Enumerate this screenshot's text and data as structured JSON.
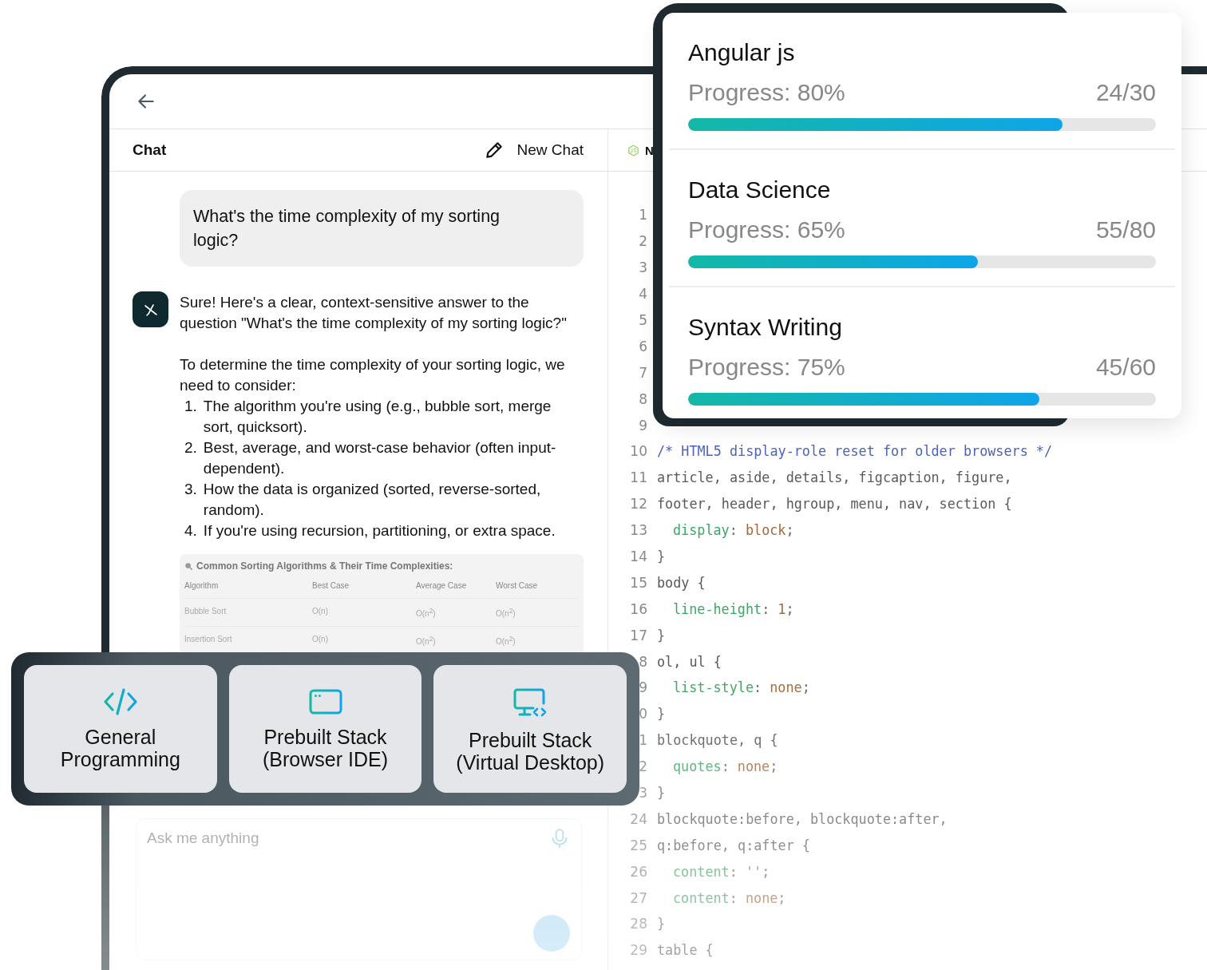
{
  "chat": {
    "title": "Chat",
    "new_chat": "New Chat",
    "messages": [
      {
        "kind": "question",
        "text": "What's the time complexity of my sorting logic?"
      },
      {
        "kind": "answer",
        "paragraphs": [
          "Sure! Here's a clear, context-sensitive answer to the question \"What's the time complexity of my sorting logic?\"",
          "To determine the time complexity of your sorting logic, we need to consider:"
        ],
        "list": [
          {
            "number": "1.",
            "text": "The algorithm you're using (e.g., bubble sort, merge sort, quicksort)."
          },
          {
            "number": "2.",
            "text": "Best, average, and worst-case behavior (often input-dependent)."
          },
          {
            "number": "3.",
            "text": "How the data is organized (sorted, reverse-sorted, random)."
          },
          {
            "number": "4.",
            "text": "If you're using recursion, partitioning, or extra space."
          }
        ],
        "table": {
          "title": "Common Sorting Algorithms & Their Time Complexities:",
          "columns": [
            "Algorithm",
            "Best Case",
            "Average Case",
            "Worst Case"
          ],
          "rows": [
            [
              "Bubble Sort",
              "O(n)",
              "O(n$^{2}$)",
              "O(n$^{2}$)"
            ],
            [
              "Insertion Sort",
              "O(n)",
              "O(n$^{2}$)",
              "O(n$^{2}$)"
            ]
          ]
        }
      }
    ],
    "input": {
      "placeholder": "Ask me anything"
    }
  },
  "editor": {
    "tab": {
      "label": "N"
    },
    "lines": [
      {
        "number": "1"
      },
      {
        "number": "2"
      },
      {
        "number": "3"
      },
      {
        "number": "4"
      },
      {
        "number": "5"
      },
      {
        "number": "6"
      },
      {
        "number": "7"
      },
      {
        "number": "8"
      },
      {
        "number": "9"
      },
      {
        "number": "10",
        "indented": false,
        "segments": [
          {
            "kind": "comment",
            "text": "/* HTML5 display-role reset for older browsers */"
          }
        ]
      },
      {
        "number": "11",
        "indented": false,
        "segments": [
          {
            "kind": "selector",
            "text": "article, aside, details, figcaption, figure,"
          }
        ]
      },
      {
        "number": "12",
        "indented": false,
        "segments": [
          {
            "kind": "selector",
            "text": "footer, header, hgroup, menu, nav, section {"
          }
        ]
      },
      {
        "number": "13",
        "indented": true,
        "segments": [
          {
            "kind": "property",
            "text": "display"
          },
          {
            "kind": "punct",
            "text": ":"
          },
          {
            "kind": "value",
            "text": "block"
          },
          {
            "kind": "punct",
            "text": ";"
          }
        ]
      },
      {
        "number": "14",
        "indented": false,
        "segments": [
          {
            "kind": "punct",
            "text": "}"
          }
        ]
      },
      {
        "number": "15",
        "indented": false,
        "segments": [
          {
            "kind": "selector",
            "text": "body {"
          }
        ]
      },
      {
        "number": "16",
        "indented": true,
        "segments": [
          {
            "kind": "property",
            "text": "line-height"
          },
          {
            "kind": "punct",
            "text": ":"
          },
          {
            "kind": "value",
            "text": "1"
          },
          {
            "kind": "punct",
            "text": ";"
          }
        ]
      },
      {
        "number": "17",
        "indented": false,
        "segments": [
          {
            "kind": "punct",
            "text": "}"
          }
        ]
      },
      {
        "number": "8",
        "indented": false,
        "segments": [
          {
            "kind": "selector",
            "text": "ol, ul {"
          }
        ]
      },
      {
        "number": "9",
        "indented": true,
        "segments": [
          {
            "kind": "property",
            "text": "list-style"
          },
          {
            "kind": "punct",
            "text": ":"
          },
          {
            "kind": "value",
            "text": "none"
          },
          {
            "kind": "punct",
            "text": ";"
          }
        ]
      },
      {
        "number": "0",
        "indented": false,
        "segments": [
          {
            "kind": "punct",
            "text": "}"
          }
        ]
      },
      {
        "number": "1",
        "indented": false,
        "segments": [
          {
            "kind": "selector",
            "text": "blockquote, q {"
          }
        ]
      },
      {
        "number": "2",
        "indented": true,
        "segments": [
          {
            "kind": "property",
            "text": "quotes"
          },
          {
            "kind": "punct",
            "text": ":"
          },
          {
            "kind": "value",
            "text": "none"
          },
          {
            "kind": "punct",
            "text": ";"
          }
        ]
      },
      {
        "number": "3",
        "indented": false,
        "segments": [
          {
            "kind": "punct",
            "text": "}"
          }
        ]
      },
      {
        "number": "24",
        "indented": false,
        "segments": [
          {
            "kind": "selector",
            "text": "blockquote:before, blockquote:after,"
          }
        ]
      },
      {
        "number": "25",
        "indented": false,
        "segments": [
          {
            "kind": "selector",
            "text": "q:before, q:after {"
          }
        ]
      },
      {
        "number": "26",
        "indented": true,
        "segments": [
          {
            "kind": "property",
            "text": "content"
          },
          {
            "kind": "punct",
            "text": ":"
          },
          {
            "kind": "value",
            "text": "''"
          },
          {
            "kind": "punct",
            "text": ";"
          }
        ]
      },
      {
        "number": "27",
        "indented": true,
        "segments": [
          {
            "kind": "property",
            "text": "content"
          },
          {
            "kind": "punct",
            "text": ":"
          },
          {
            "kind": "value",
            "text": "none"
          },
          {
            "kind": "punct",
            "text": ";"
          }
        ]
      },
      {
        "number": "28",
        "indented": false,
        "segments": [
          {
            "kind": "punct",
            "text": "}"
          }
        ]
      },
      {
        "number": "29",
        "indented": false,
        "segments": [
          {
            "kind": "selector",
            "text": "table {"
          }
        ]
      }
    ]
  },
  "courses": [
    {
      "title": "Angular js",
      "progress": "Progress: 80%",
      "count": "24/30",
      "level": 0.8
    },
    {
      "title": "Data Science",
      "progress": "Progress: 65%",
      "count": "55/80",
      "level": 0.62
    },
    {
      "title": "Syntax Writing",
      "progress": "Progress: 75%",
      "count": "45/60",
      "level": 0.75
    }
  ],
  "modes": [
    {
      "kind": "code",
      "label": "General Programming"
    },
    {
      "kind": "browser",
      "label": "Prebuilt Stack (Browser IDE)"
    },
    {
      "kind": "desktop",
      "label": "Prebuilt Stack (Virtual Desktop)"
    }
  ]
}
